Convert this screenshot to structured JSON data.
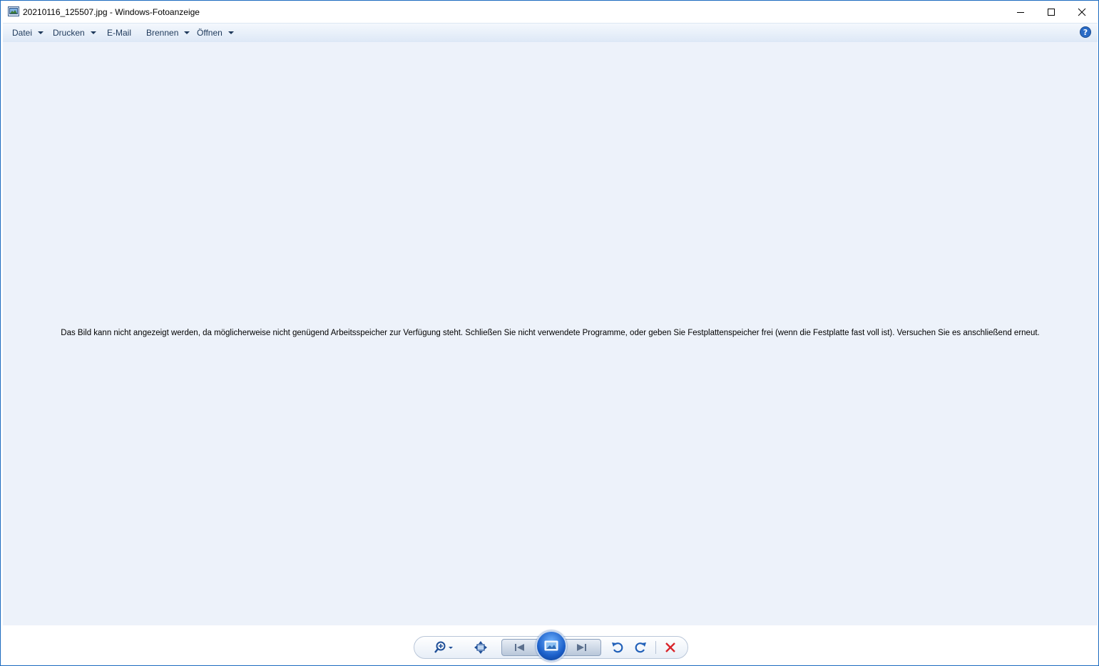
{
  "window": {
    "title": "20210116_125507.jpg - Windows-Fotoanzeige",
    "buttons": {
      "minimize_icon": "minimize-icon",
      "maximize_icon": "maximize-icon",
      "close_icon": "close-icon"
    }
  },
  "menu": {
    "items": [
      {
        "label": "Datei",
        "has_dropdown": true
      },
      {
        "label": "Drucken",
        "has_dropdown": true
      },
      {
        "label": "E-Mail",
        "has_dropdown": false
      },
      {
        "label": "Brennen",
        "has_dropdown": true
      },
      {
        "label": "Öffnen",
        "has_dropdown": true
      }
    ],
    "help_icon": "help-icon"
  },
  "content": {
    "message": "Das Bild kann nicht angezeigt werden, da möglicherweise nicht genügend Arbeitsspeicher zur Verfügung steht. Schließen Sie nicht verwendete Programme, oder geben Sie Festplattenspeicher frei (wenn die Festplatte fast voll ist). Versuchen Sie es anschließend erneut."
  },
  "controls": {
    "zoom_icon": "zoom-icon",
    "fit_icon": "actual-size-icon",
    "previous_icon": "previous-icon",
    "slideshow_icon": "slideshow-icon",
    "next_icon": "next-icon",
    "rotate_left_icon": "rotate-counterclockwise-icon",
    "rotate_right_icon": "rotate-clockwise-icon",
    "delete_icon": "delete-icon"
  },
  "colors": {
    "content_background": "#edf2fa",
    "window_border": "#1c6bbf",
    "delete_red": "#d9252b",
    "rotate_blue": "#1f5fb8"
  }
}
